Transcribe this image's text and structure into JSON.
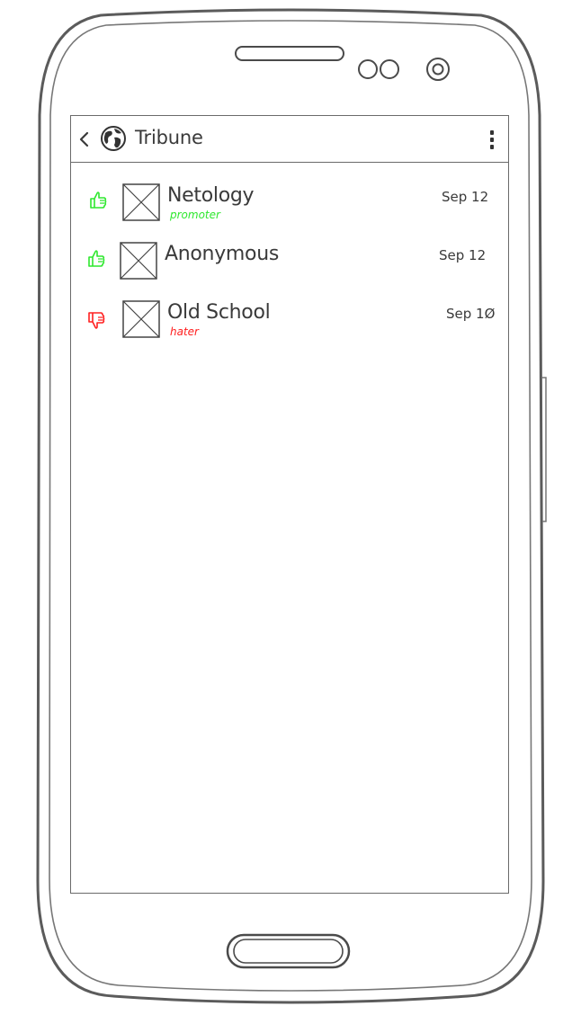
{
  "app_bar": {
    "title": "Tribune"
  },
  "reviews": [
    {
      "name": "Netology",
      "tag": "promoter",
      "tag_color": "#2ee82e",
      "date": "Sep 12",
      "vote": "thumbs-up",
      "vote_color": "#2ee82e"
    },
    {
      "name": "Anonymous",
      "tag": "",
      "tag_color": "",
      "date": "Sep 12",
      "vote": "thumbs-up",
      "vote_color": "#2ee82e"
    },
    {
      "name": "Old School",
      "tag": "hater",
      "tag_color": "#ff2020",
      "date": "Sep 1Ø",
      "vote": "thumbs-down",
      "vote_color": "#ff2020"
    }
  ],
  "icons": {
    "back": "chevron-left-icon",
    "globe": "globe-icon",
    "menu": "more-vertical-icon",
    "avatar_placeholder": "image-placeholder-icon"
  },
  "colors": {
    "outline": "#4a4a4a",
    "text": "#3a3a3a",
    "positive": "#2ee82e",
    "negative": "#ff2020"
  }
}
